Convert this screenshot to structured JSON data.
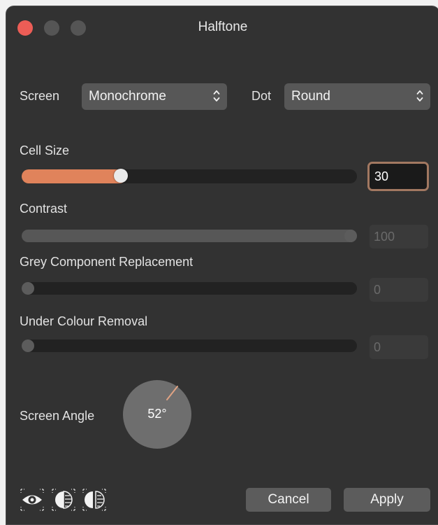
{
  "window": {
    "title": "Halftone"
  },
  "screen": {
    "label": "Screen",
    "value": "Monochrome"
  },
  "dot": {
    "label": "Dot",
    "value": "Round"
  },
  "cell_size": {
    "label": "Cell Size",
    "value": "30",
    "level": 0.3
  },
  "contrast": {
    "label": "Contrast",
    "value": "100",
    "level": 1.0
  },
  "gcr": {
    "label": "Grey Component Replacement",
    "value": "0",
    "level": 0
  },
  "ucr": {
    "label": "Under Colour Removal",
    "value": "0",
    "level": 0
  },
  "screen_angle": {
    "label": "Screen Angle",
    "value": "52°",
    "degrees": 52
  },
  "buttons": {
    "cancel": "Cancel",
    "apply": "Apply"
  },
  "colors": {
    "accent": "#e0835b",
    "close": "#ec5d56",
    "active_border": "#a27861"
  },
  "icons": [
    "preview-eye-icon",
    "split-compare-icon",
    "mirror-compare-icon"
  ]
}
